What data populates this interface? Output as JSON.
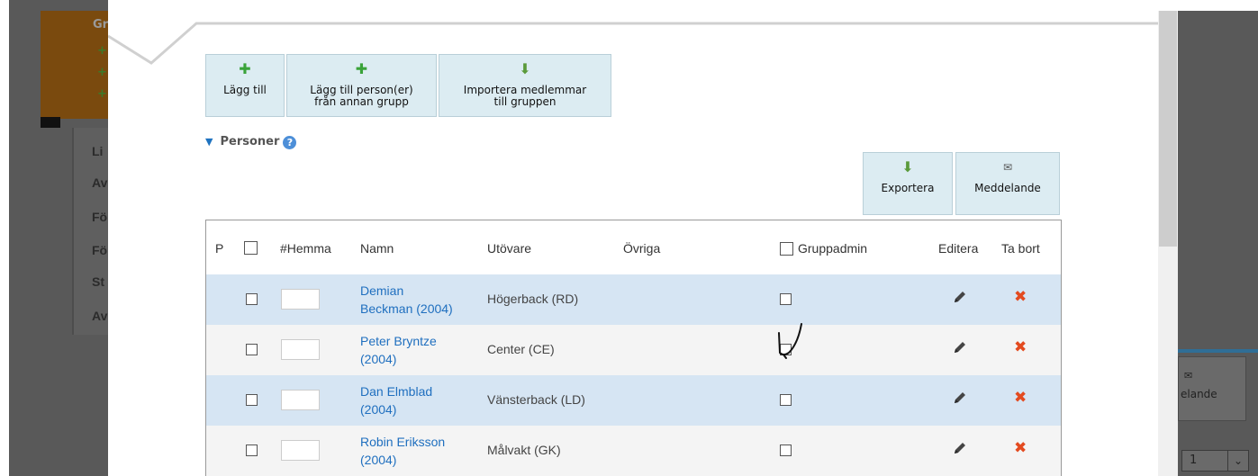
{
  "background_left": {
    "group_letter": "Gr",
    "menu_items": [
      "Li",
      "Av",
      "Fö",
      "Fö",
      "St",
      "Av"
    ]
  },
  "background_right": {
    "button_label": "elande",
    "page_select": "1"
  },
  "toolbar": {
    "add": "Lägg till",
    "add_from_group": "Lägg till person(er)\nfrån annan grupp",
    "import": "Importera medlemmar\ntill gruppen"
  },
  "section": {
    "title": "Personer",
    "help": "?"
  },
  "actions": {
    "export": "Exportera",
    "message": "Meddelande"
  },
  "table": {
    "columns": {
      "p": "P",
      "hemma": "#Hemma",
      "namn": "Namn",
      "utovare": "Utövare",
      "ovriga": "Övriga",
      "gruppadmin": "Gruppadmin",
      "editera": "Editera",
      "ta_bort": "Ta bort"
    },
    "rows": [
      {
        "name_line1": "Demian",
        "name_line2": "Beckman (2004)",
        "position": "Högerback (RD)"
      },
      {
        "name_line1": "Peter Bryntze",
        "name_line2": "(2004)",
        "position": "Center (CE)"
      },
      {
        "name_line1": "Dan Elmblad",
        "name_line2": "(2004)",
        "position": "Vänsterback (LD)"
      },
      {
        "name_line1": "Robin Eriksson",
        "name_line2": "(2004)",
        "position": "Målvakt (GK)"
      }
    ]
  },
  "colors": {
    "row_highlight": "#d6e5f3",
    "row_plain": "#f4f4f4",
    "link": "#1f6fbf",
    "delete": "#e34a1f",
    "button_bg": "#dcecf2"
  }
}
